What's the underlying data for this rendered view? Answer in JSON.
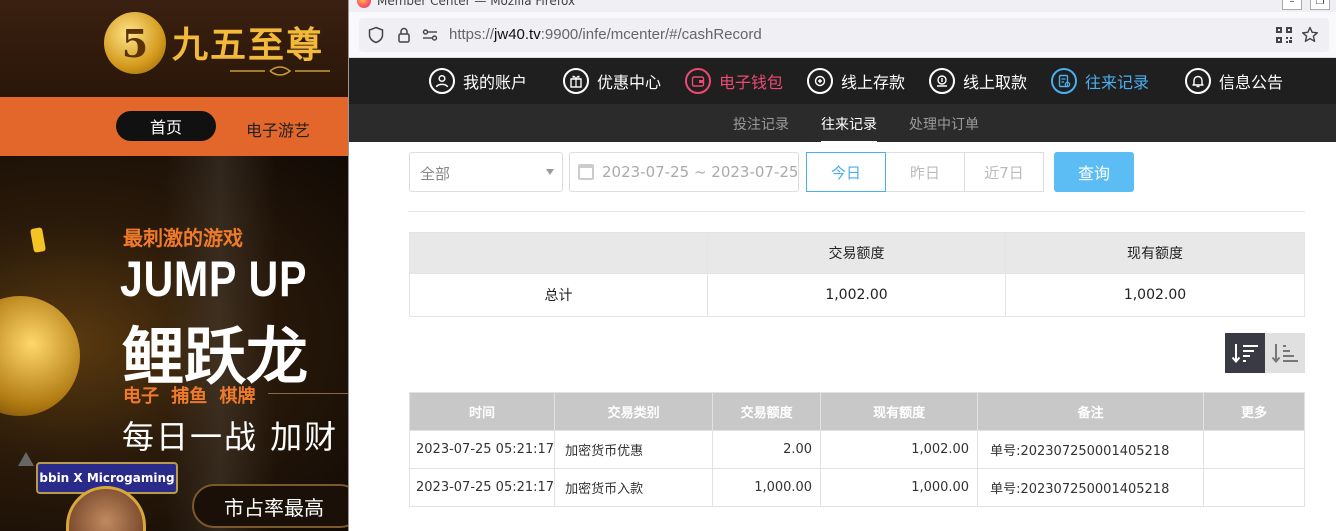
{
  "window": {
    "title": "Member Center — Mozilla Firefox",
    "url_prefix": "https://",
    "url_domain": "jw40.tv",
    "url_rest": ":9900/infe/mcenter/#/cashRecord"
  },
  "background_site": {
    "logo_mark": "5",
    "logo_text": "九五至尊",
    "nav_home": "首页",
    "nav_games": "电子游艺",
    "banner_tag": "最刺激的游戏",
    "banner_title_en": "JUMP UP",
    "banner_title_cn": "鲤跃龙",
    "banner_categories": "电子 捕鱼 棋牌",
    "banner_slogan": "每日一战 加财",
    "partner_label": "bbin X Microgaming",
    "cta": "市占率最高"
  },
  "topnav": [
    {
      "label": "我的账户",
      "icon": "user-icon",
      "state": "normal"
    },
    {
      "label": "优惠中心",
      "icon": "gift-icon",
      "state": "normal"
    },
    {
      "label": "电子钱包",
      "icon": "wallet-icon",
      "state": "wallet"
    },
    {
      "label": "线上存款",
      "icon": "deposit-icon",
      "state": "normal"
    },
    {
      "label": "线上取款",
      "icon": "withdraw-icon",
      "state": "normal"
    },
    {
      "label": "往来记录",
      "icon": "records-icon",
      "state": "active"
    },
    {
      "label": "信息公告",
      "icon": "bell-icon",
      "state": "normal"
    }
  ],
  "subnav": [
    {
      "label": "投注记录",
      "active": false
    },
    {
      "label": "往来记录",
      "active": true
    },
    {
      "label": "处理中订单",
      "active": false
    }
  ],
  "filter": {
    "type_value": "全部",
    "date_range": "2023-07-25 ~ 2023-07-25",
    "quick_today": "今日",
    "quick_yesterday": "昨日",
    "quick_7days": "近7日",
    "query_label": "查询"
  },
  "summary": {
    "headers": [
      "",
      "交易额度",
      "现有额度"
    ],
    "row": {
      "label": "总计",
      "amount": "1,002.00",
      "balance": "1,002.00"
    }
  },
  "records": {
    "headers": [
      "时间",
      "交易类别",
      "交易额度",
      "现有额度",
      "备注",
      "更多"
    ],
    "rows": [
      {
        "time": "2023-07-25 05:21:17",
        "type": "加密货币优惠",
        "amount": "2.00",
        "balance": "1,002.00",
        "note": "单号:202307250001405218",
        "more": ""
      },
      {
        "time": "2023-07-25 05:21:17",
        "type": "加密货币入款",
        "amount": "1,000.00",
        "balance": "1,000.00",
        "note": "单号:202307250001405218",
        "more": ""
      }
    ]
  },
  "colors": {
    "accent_blue": "#4aaef0",
    "wallet_pink": "#ec4a74",
    "nav_bg": "#1f1f1f",
    "query_button": "#5cbcf4"
  }
}
